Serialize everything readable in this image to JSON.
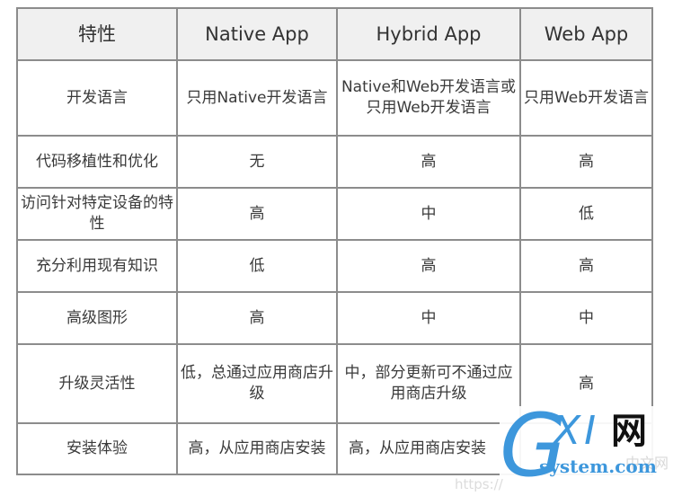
{
  "table": {
    "headers": [
      "特性",
      "Native App",
      "Hybrid App",
      "Web App"
    ],
    "rows": [
      {
        "feature": "开发语言",
        "native": "只用Native开发语言",
        "hybrid": "Native和Web开发语言或只用Web开发语言",
        "web": "只用Web开发语言"
      },
      {
        "feature": "代码移植性和优化",
        "native": "无",
        "hybrid": "高",
        "web": "高"
      },
      {
        "feature": "访问针对特定设备的特性",
        "native": "高",
        "hybrid": "中",
        "web": "低"
      },
      {
        "feature": "充分利用现有知识",
        "native": "低",
        "hybrid": "高",
        "web": "高"
      },
      {
        "feature": "高级图形",
        "native": "高",
        "hybrid": "中",
        "web": "中"
      },
      {
        "feature": "升级灵活性",
        "native": "低，总通过应用商店升级",
        "hybrid": "中，部分更新可不通过应用商店升级",
        "web": "高"
      },
      {
        "feature": "安装体验",
        "native": "高，从应用商店安装",
        "hybrid": "高，从应用商店安装",
        "web": ""
      }
    ]
  },
  "watermark": {
    "g": "G",
    "xi": "XI",
    "net": "网",
    "domain": "system.com",
    "faint_text": "中文网",
    "url_fragment": "https://"
  },
  "colors": {
    "header_bg": "#f0f0f0",
    "border": "#8c8c8c",
    "watermark_blue": "#3d97dc"
  }
}
